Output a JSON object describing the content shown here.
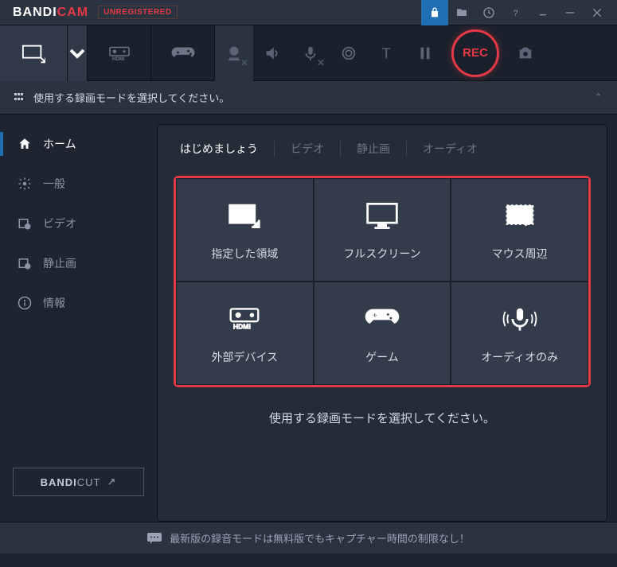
{
  "titlebar": {
    "brand_a": "BANDI",
    "brand_b": "CAM",
    "unregistered": "UNREGISTERED"
  },
  "mode_bar": {
    "text": "使用する録画モードを選択してください。"
  },
  "sidebar": {
    "items": [
      {
        "label": "ホーム"
      },
      {
        "label": "一般"
      },
      {
        "label": "ビデオ"
      },
      {
        "label": "静止画"
      },
      {
        "label": "情報"
      }
    ],
    "bandicut_a": "BANDI",
    "bandicut_b": "CUT"
  },
  "tabs": [
    {
      "label": "はじめましょう"
    },
    {
      "label": "ビデオ"
    },
    {
      "label": "静止画"
    },
    {
      "label": "オーディオ"
    }
  ],
  "grid": [
    {
      "label": "指定した領域"
    },
    {
      "label": "フルスクリーン"
    },
    {
      "label": "マウス周辺"
    },
    {
      "label": "外部デバイス"
    },
    {
      "label": "ゲーム"
    },
    {
      "label": "オーディオのみ"
    }
  ],
  "hint": "使用する録画モードを選択してください。",
  "rec": "REC",
  "footer": "最新版の録音モードは無料版でもキャプチャー時間の制限なし！"
}
